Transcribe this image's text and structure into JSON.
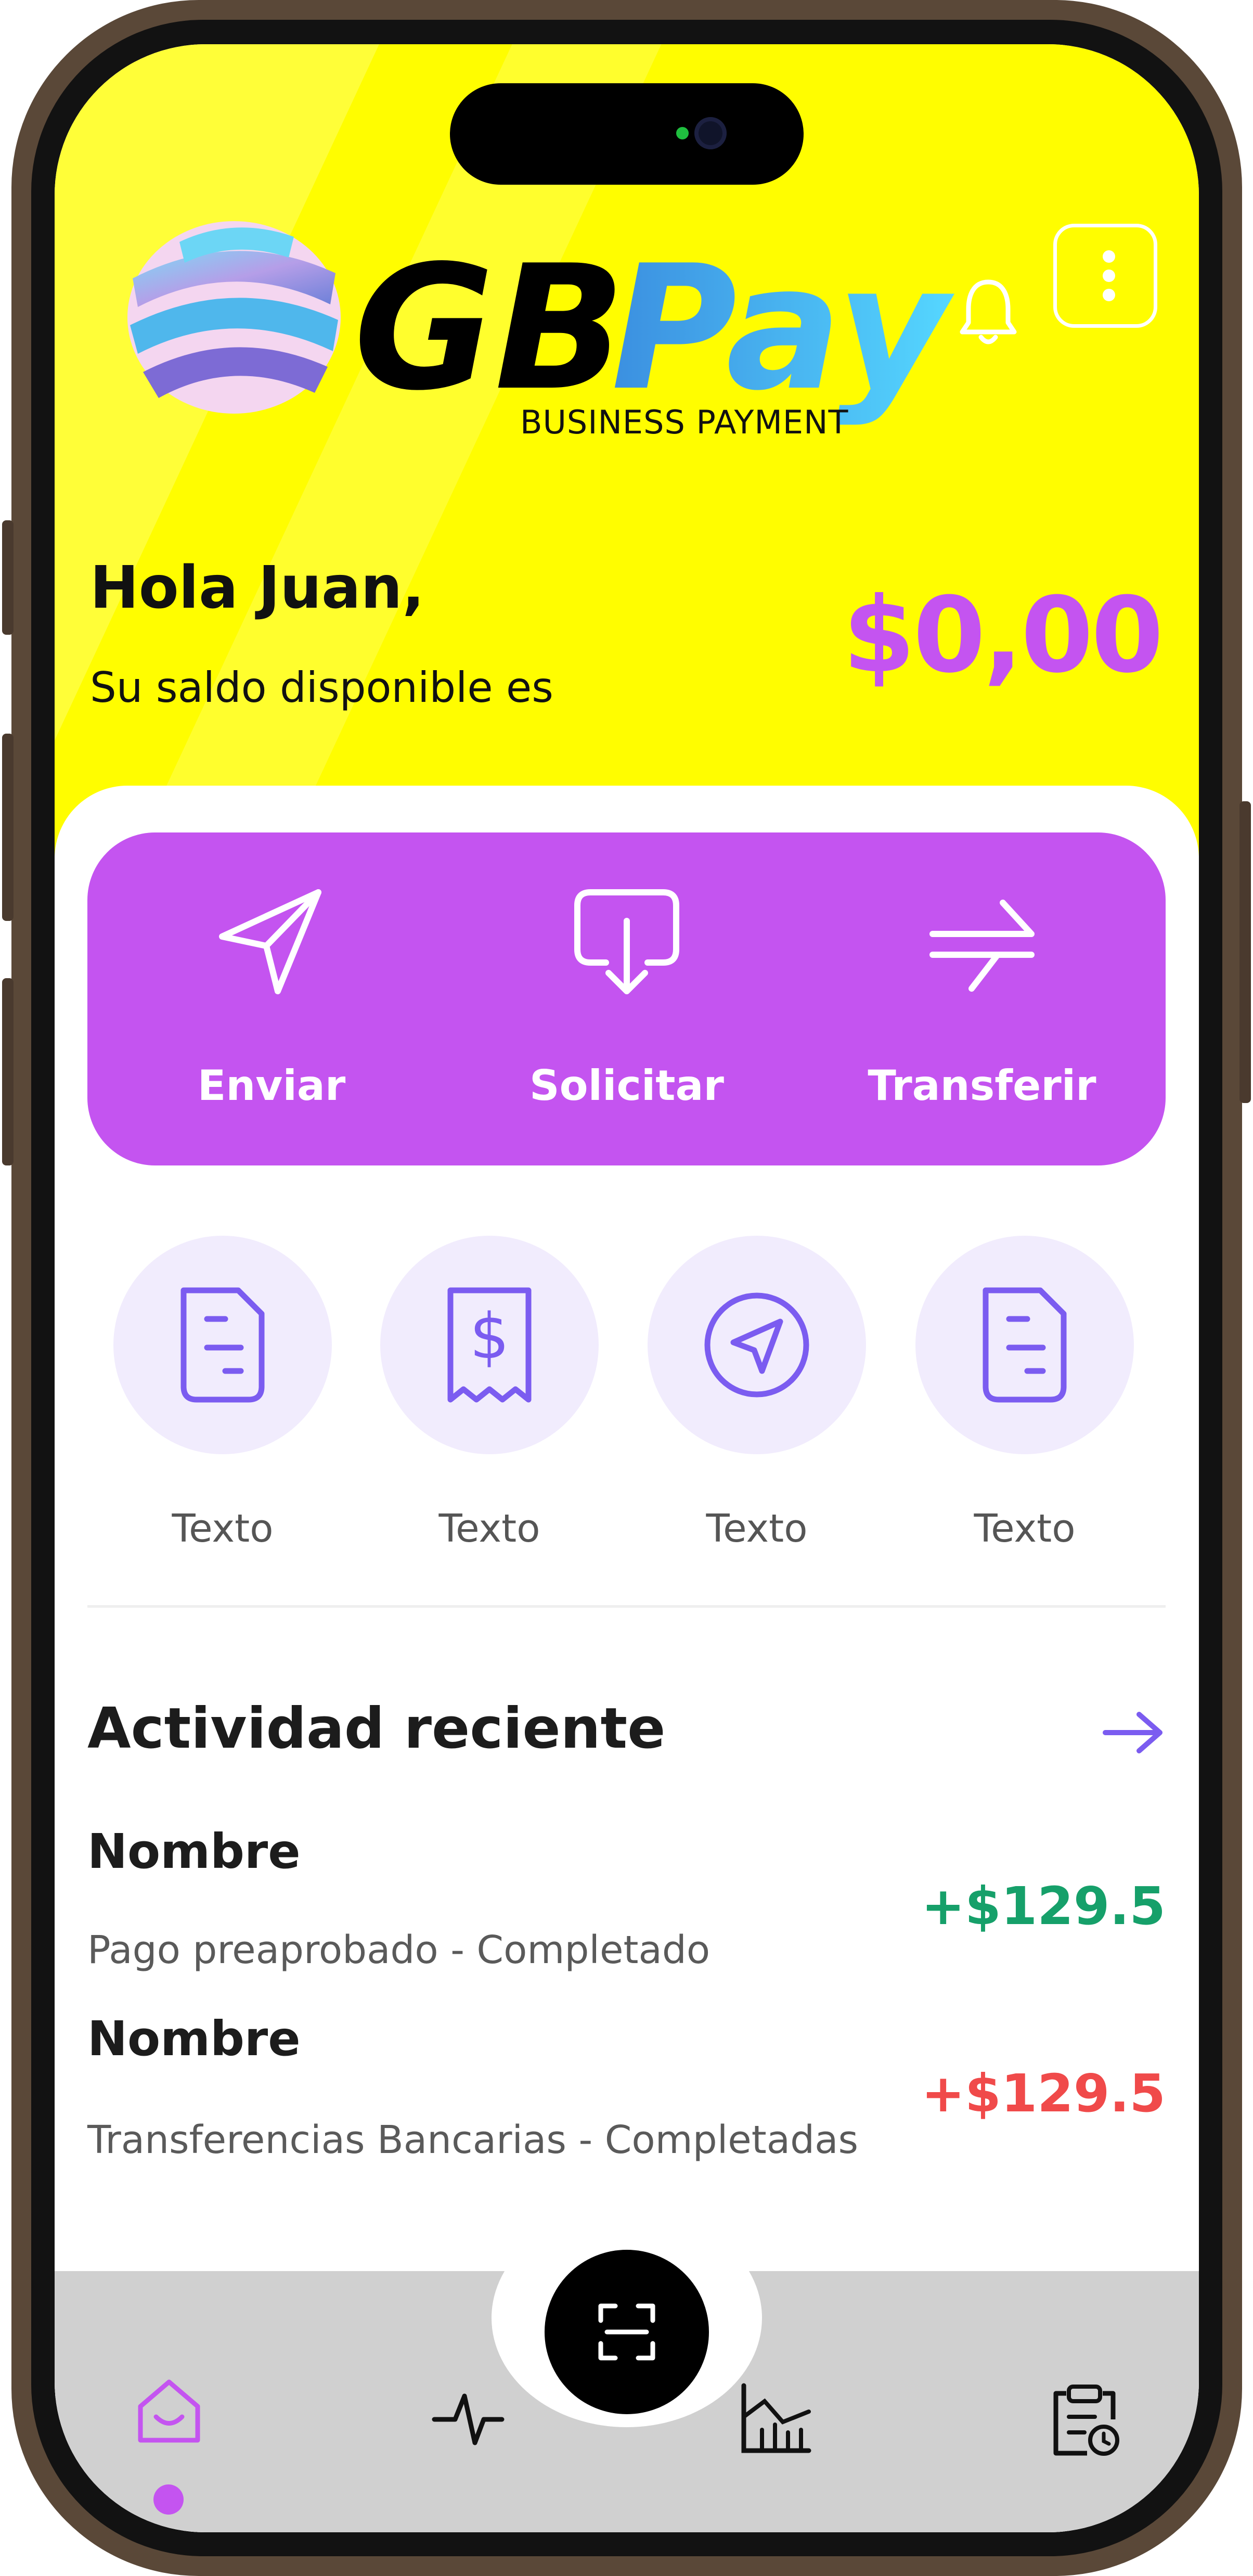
{
  "app": {
    "logo_text": "GBPay",
    "logo_subtitle": "BUSINESS PAYMENT"
  },
  "header": {
    "greeting": "Hola Juan,",
    "balance_label": "Su saldo disponible es",
    "balance": "$0,00"
  },
  "actions": [
    {
      "label": "Enviar",
      "icon": "send-icon"
    },
    {
      "label": "Solicitar",
      "icon": "request-icon"
    },
    {
      "label": "Transferir",
      "icon": "transfer-icon"
    }
  ],
  "quick_actions": [
    {
      "label": "Texto",
      "icon": "document-icon"
    },
    {
      "label": "Texto",
      "icon": "receipt-icon"
    },
    {
      "label": "Texto",
      "icon": "navigate-icon"
    },
    {
      "label": "Texto",
      "icon": "document-icon"
    }
  ],
  "activity": {
    "title": "Actividad reciente",
    "items": [
      {
        "name": "Nombre",
        "description": "Pago preaprobado - Completado",
        "amount": "+$129.5",
        "color": "#16a06a"
      },
      {
        "name": "Nombre",
        "description": "Transferencias Bancarias - Completadas",
        "amount": "+$129.5",
        "color": "#f04a4a"
      }
    ]
  },
  "nav": {
    "items": [
      "home-icon",
      "activity-icon",
      "chart-icon",
      "clipboard-icon"
    ],
    "center": "scan-icon",
    "active": "home-icon"
  },
  "colors": {
    "primary": "#c454f0",
    "header_bg": "#fffd00",
    "icon_accent": "#7b5cf0",
    "positive": "#16a06a",
    "negative": "#f04a4a"
  }
}
